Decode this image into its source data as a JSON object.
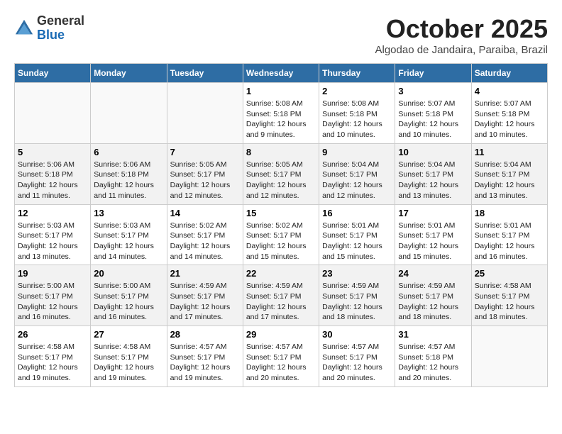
{
  "header": {
    "logo_general": "General",
    "logo_blue": "Blue",
    "month_title": "October 2025",
    "subtitle": "Algodao de Jandaira, Paraiba, Brazil"
  },
  "days_of_week": [
    "Sunday",
    "Monday",
    "Tuesday",
    "Wednesday",
    "Thursday",
    "Friday",
    "Saturday"
  ],
  "weeks": [
    [
      {
        "day": "",
        "info": ""
      },
      {
        "day": "",
        "info": ""
      },
      {
        "day": "",
        "info": ""
      },
      {
        "day": "1",
        "info": "Sunrise: 5:08 AM\nSunset: 5:18 PM\nDaylight: 12 hours\nand 9 minutes."
      },
      {
        "day": "2",
        "info": "Sunrise: 5:08 AM\nSunset: 5:18 PM\nDaylight: 12 hours\nand 10 minutes."
      },
      {
        "day": "3",
        "info": "Sunrise: 5:07 AM\nSunset: 5:18 PM\nDaylight: 12 hours\nand 10 minutes."
      },
      {
        "day": "4",
        "info": "Sunrise: 5:07 AM\nSunset: 5:18 PM\nDaylight: 12 hours\nand 10 minutes."
      }
    ],
    [
      {
        "day": "5",
        "info": "Sunrise: 5:06 AM\nSunset: 5:18 PM\nDaylight: 12 hours\nand 11 minutes."
      },
      {
        "day": "6",
        "info": "Sunrise: 5:06 AM\nSunset: 5:18 PM\nDaylight: 12 hours\nand 11 minutes."
      },
      {
        "day": "7",
        "info": "Sunrise: 5:05 AM\nSunset: 5:17 PM\nDaylight: 12 hours\nand 12 minutes."
      },
      {
        "day": "8",
        "info": "Sunrise: 5:05 AM\nSunset: 5:17 PM\nDaylight: 12 hours\nand 12 minutes."
      },
      {
        "day": "9",
        "info": "Sunrise: 5:04 AM\nSunset: 5:17 PM\nDaylight: 12 hours\nand 12 minutes."
      },
      {
        "day": "10",
        "info": "Sunrise: 5:04 AM\nSunset: 5:17 PM\nDaylight: 12 hours\nand 13 minutes."
      },
      {
        "day": "11",
        "info": "Sunrise: 5:04 AM\nSunset: 5:17 PM\nDaylight: 12 hours\nand 13 minutes."
      }
    ],
    [
      {
        "day": "12",
        "info": "Sunrise: 5:03 AM\nSunset: 5:17 PM\nDaylight: 12 hours\nand 13 minutes."
      },
      {
        "day": "13",
        "info": "Sunrise: 5:03 AM\nSunset: 5:17 PM\nDaylight: 12 hours\nand 14 minutes."
      },
      {
        "day": "14",
        "info": "Sunrise: 5:02 AM\nSunset: 5:17 PM\nDaylight: 12 hours\nand 14 minutes."
      },
      {
        "day": "15",
        "info": "Sunrise: 5:02 AM\nSunset: 5:17 PM\nDaylight: 12 hours\nand 15 minutes."
      },
      {
        "day": "16",
        "info": "Sunrise: 5:01 AM\nSunset: 5:17 PM\nDaylight: 12 hours\nand 15 minutes."
      },
      {
        "day": "17",
        "info": "Sunrise: 5:01 AM\nSunset: 5:17 PM\nDaylight: 12 hours\nand 15 minutes."
      },
      {
        "day": "18",
        "info": "Sunrise: 5:01 AM\nSunset: 5:17 PM\nDaylight: 12 hours\nand 16 minutes."
      }
    ],
    [
      {
        "day": "19",
        "info": "Sunrise: 5:00 AM\nSunset: 5:17 PM\nDaylight: 12 hours\nand 16 minutes."
      },
      {
        "day": "20",
        "info": "Sunrise: 5:00 AM\nSunset: 5:17 PM\nDaylight: 12 hours\nand 16 minutes."
      },
      {
        "day": "21",
        "info": "Sunrise: 4:59 AM\nSunset: 5:17 PM\nDaylight: 12 hours\nand 17 minutes."
      },
      {
        "day": "22",
        "info": "Sunrise: 4:59 AM\nSunset: 5:17 PM\nDaylight: 12 hours\nand 17 minutes."
      },
      {
        "day": "23",
        "info": "Sunrise: 4:59 AM\nSunset: 5:17 PM\nDaylight: 12 hours\nand 18 minutes."
      },
      {
        "day": "24",
        "info": "Sunrise: 4:59 AM\nSunset: 5:17 PM\nDaylight: 12 hours\nand 18 minutes."
      },
      {
        "day": "25",
        "info": "Sunrise: 4:58 AM\nSunset: 5:17 PM\nDaylight: 12 hours\nand 18 minutes."
      }
    ],
    [
      {
        "day": "26",
        "info": "Sunrise: 4:58 AM\nSunset: 5:17 PM\nDaylight: 12 hours\nand 19 minutes."
      },
      {
        "day": "27",
        "info": "Sunrise: 4:58 AM\nSunset: 5:17 PM\nDaylight: 12 hours\nand 19 minutes."
      },
      {
        "day": "28",
        "info": "Sunrise: 4:57 AM\nSunset: 5:17 PM\nDaylight: 12 hours\nand 19 minutes."
      },
      {
        "day": "29",
        "info": "Sunrise: 4:57 AM\nSunset: 5:17 PM\nDaylight: 12 hours\nand 20 minutes."
      },
      {
        "day": "30",
        "info": "Sunrise: 4:57 AM\nSunset: 5:17 PM\nDaylight: 12 hours\nand 20 minutes."
      },
      {
        "day": "31",
        "info": "Sunrise: 4:57 AM\nSunset: 5:18 PM\nDaylight: 12 hours\nand 20 minutes."
      },
      {
        "day": "",
        "info": ""
      }
    ]
  ]
}
